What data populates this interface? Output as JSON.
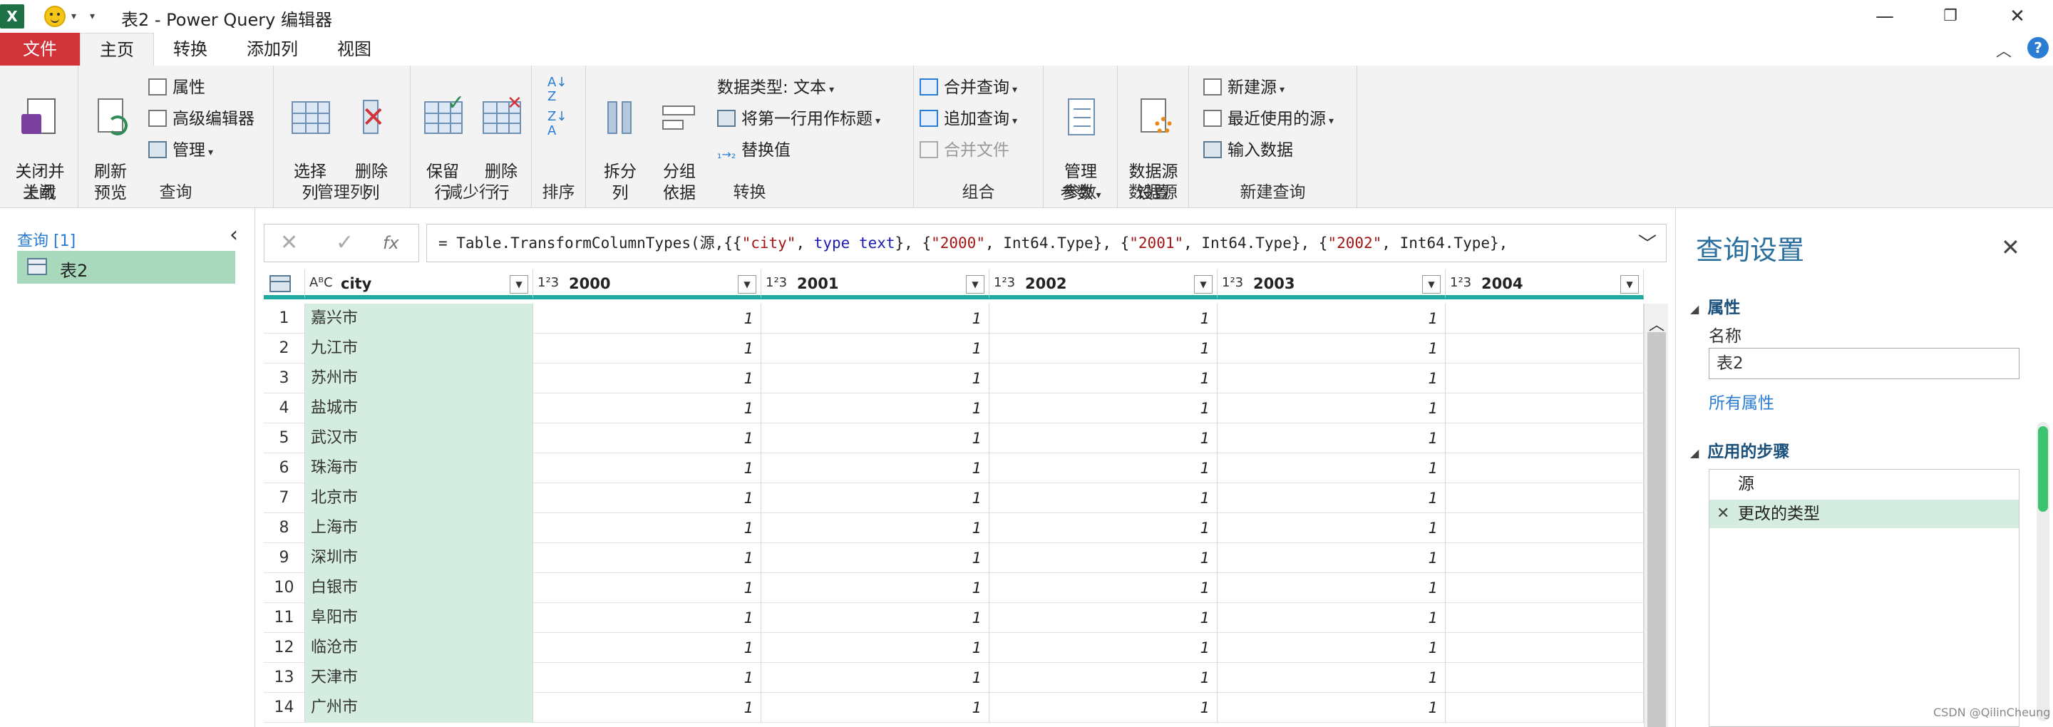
{
  "titlebar": {
    "app_logo": "X",
    "title": "表2 - Power Query 编辑器",
    "icons": [
      "excel-logo",
      "smiley-icon",
      "customize-caret"
    ]
  },
  "menu": {
    "tabs": [
      {
        "label": "文件"
      },
      {
        "label": "主页"
      },
      {
        "label": "转换"
      },
      {
        "label": "添加列"
      },
      {
        "label": "视图"
      }
    ],
    "help": "?"
  },
  "ribbon": {
    "groups": {
      "close": {
        "label": "关闭",
        "close_load": "关闭并\n上载"
      },
      "query": {
        "label": "查询",
        "refresh": "刷新\n预览",
        "properties": "属性",
        "advanced_editor": "高级编辑器",
        "manage": "管理"
      },
      "manage_cols": {
        "label": "管理列",
        "choose": "选择\n列",
        "remove": "删除\n列"
      },
      "reduce_rows": {
        "label": "减少行",
        "keep": "保留\n行",
        "remove": "删除\n行"
      },
      "sort": {
        "label": "排序"
      },
      "transform": {
        "label": "转换",
        "split": "拆分\n列",
        "group": "分组\n依据",
        "datatype": "数据类型: 文本",
        "first_row": "将第一行用作标题",
        "replace": "替换值"
      },
      "combine": {
        "label": "组合",
        "merge": "合并查询",
        "append": "追加查询",
        "merge_files": "合并文件"
      },
      "params": {
        "label": "参数",
        "manage": "管理\n参数"
      },
      "datasource": {
        "label": "数据源",
        "settings": "数据源\n设置"
      },
      "new_query": {
        "label": "新建查询",
        "new_source": "新建源",
        "recent": "最近使用的源",
        "enter": "输入数据"
      }
    }
  },
  "queries": {
    "header": "查询 [1]",
    "items": [
      {
        "label": "表2"
      }
    ]
  },
  "formula": {
    "cancel": "✕",
    "commit": "✓",
    "fx": "fx",
    "prefix": "= Table.TransformColumnTypes(源,{{",
    "parts": [
      {
        "t": "str",
        "v": "\"city\""
      },
      {
        "t": "txt",
        "v": ", "
      },
      {
        "t": "kw",
        "v": "type text"
      },
      {
        "t": "txt",
        "v": "}, {"
      },
      {
        "t": "str",
        "v": "\"2000\""
      },
      {
        "t": "txt",
        "v": ", Int64.Type}, {"
      },
      {
        "t": "str",
        "v": "\"2001\""
      },
      {
        "t": "txt",
        "v": ", Int64.Type}, {"
      },
      {
        "t": "str",
        "v": "\"2002\""
      },
      {
        "t": "txt",
        "v": ", Int64.Type},"
      }
    ]
  },
  "table": {
    "columns": [
      {
        "type": "AᴮC",
        "name": "city"
      },
      {
        "type": "1²3",
        "name": "2000"
      },
      {
        "type": "1²3",
        "name": "2001"
      },
      {
        "type": "1²3",
        "name": "2002"
      },
      {
        "type": "1²3",
        "name": "2003"
      },
      {
        "type": "1²3",
        "name": "2004"
      }
    ],
    "rows": [
      {
        "n": "1",
        "city": "嘉兴市",
        "v": [
          "1",
          "1",
          "1",
          "1"
        ]
      },
      {
        "n": "2",
        "city": "九江市",
        "v": [
          "1",
          "1",
          "1",
          "1"
        ]
      },
      {
        "n": "3",
        "city": "苏州市",
        "v": [
          "1",
          "1",
          "1",
          "1"
        ]
      },
      {
        "n": "4",
        "city": "盐城市",
        "v": [
          "1",
          "1",
          "1",
          "1"
        ]
      },
      {
        "n": "5",
        "city": "武汉市",
        "v": [
          "1",
          "1",
          "1",
          "1"
        ]
      },
      {
        "n": "6",
        "city": "珠海市",
        "v": [
          "1",
          "1",
          "1",
          "1"
        ]
      },
      {
        "n": "7",
        "city": "北京市",
        "v": [
          "1",
          "1",
          "1",
          "1"
        ]
      },
      {
        "n": "8",
        "city": "上海市",
        "v": [
          "1",
          "1",
          "1",
          "1"
        ]
      },
      {
        "n": "9",
        "city": "深圳市",
        "v": [
          "1",
          "1",
          "1",
          "1"
        ]
      },
      {
        "n": "10",
        "city": "白银市",
        "v": [
          "1",
          "1",
          "1",
          "1"
        ]
      },
      {
        "n": "11",
        "city": "阜阳市",
        "v": [
          "1",
          "1",
          "1",
          "1"
        ]
      },
      {
        "n": "12",
        "city": "临沧市",
        "v": [
          "1",
          "1",
          "1",
          "1"
        ]
      },
      {
        "n": "13",
        "city": "天津市",
        "v": [
          "1",
          "1",
          "1",
          "1"
        ]
      },
      {
        "n": "14",
        "city": "广州市",
        "v": [
          "1",
          "1",
          "1",
          "1"
        ]
      }
    ]
  },
  "settings": {
    "title": "查询设置",
    "properties_head": "属性",
    "name_label": "名称",
    "name_value": "表2",
    "all_props": "所有属性",
    "steps_head": "应用的步骤",
    "steps": [
      {
        "label": "源"
      },
      {
        "label": "更改的类型"
      }
    ]
  },
  "watermark": "CSDN @QilinCheung",
  "colors": {
    "file_tab": "#d13438",
    "accent": "#1fa9a0",
    "selection": "#a9d9bc",
    "link": "#2b7cd3"
  }
}
